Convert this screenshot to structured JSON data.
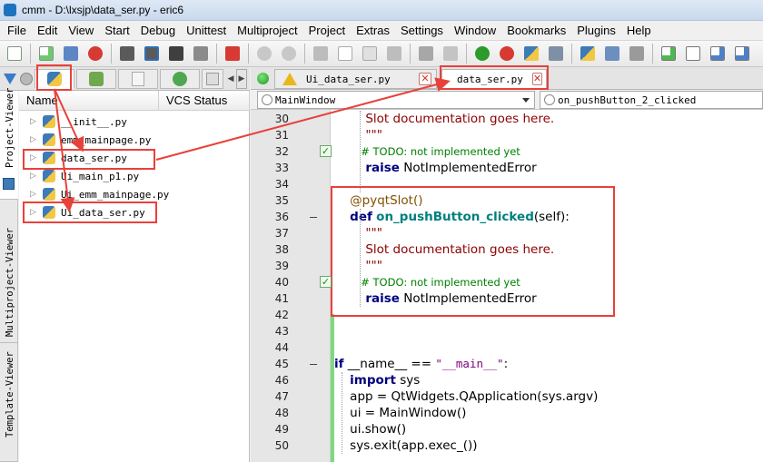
{
  "window": {
    "title": "cmm - D:\\lxsjp\\data_ser.py - eric6"
  },
  "menu": [
    "File",
    "Edit",
    "View",
    "Start",
    "Debug",
    "Unittest",
    "Multiproject",
    "Project",
    "Extras",
    "Settings",
    "Window",
    "Bookmarks",
    "Plugins",
    "Help"
  ],
  "toolbar": {
    "icons": [
      "new-file-icon",
      "new-project-icon",
      "print-icon",
      "close-red-icon",
      "save-icon",
      "save-as-icon",
      "save-all-icon",
      "save-copy-icon",
      "close-all-icon",
      "undo-icon",
      "redo-icon",
      "cut-icon",
      "copy-icon",
      "paste-icon",
      "delete-icon",
      "comment-icon",
      "next-icon",
      "reload-icon",
      "stop-icon",
      "python-run-icon",
      "settings-icon",
      "find-project-icon",
      "find-file-icon",
      "new-window-icon",
      "add-icon",
      "search-file-icon",
      "import-icon",
      "export-icon"
    ]
  },
  "sidebar": {
    "vertical_tabs": [
      "Project-Viewer",
      "Multiproject-Viewer",
      "Template-Viewer"
    ]
  },
  "filelist": {
    "columns": [
      "Name",
      "VCS Status"
    ],
    "files": [
      "__init__.py",
      "emm_mainpage.py",
      "data_ser.py",
      "Ui_main_p1.py",
      "Ui_emm_mainpage.py",
      "Ui_data_ser.py"
    ]
  },
  "editor_tabs": [
    {
      "label": "Ui_data_ser.py",
      "active": false
    },
    {
      "label": "data_ser.py",
      "active": true
    }
  ],
  "combos": {
    "class": "MainWindow",
    "method": "on_pushButton_2_clicked"
  },
  "code": {
    "lines": [
      {
        "n": "30",
        "text": "        Slot documentation goes here.",
        "cls": "s-doc"
      },
      {
        "n": "31",
        "text": "        \"\"\"",
        "cls": "s-doc"
      },
      {
        "n": "32",
        "text": "        # TODO: not implemented yet",
        "cls": "s-com"
      },
      {
        "n": "33",
        "text": "        raise NotImplementedError",
        "cls": "mixed-raise"
      },
      {
        "n": "34",
        "text": "",
        "cls": "s-pl"
      },
      {
        "n": "35",
        "text": "    @pyqtSlot()",
        "cls": "s-dec"
      },
      {
        "n": "36",
        "text": "    def on_pushButton_clicked(self):",
        "cls": "mixed-def"
      },
      {
        "n": "37",
        "text": "        \"\"\"",
        "cls": "s-doc"
      },
      {
        "n": "38",
        "text": "        Slot documentation goes here.",
        "cls": "s-doc"
      },
      {
        "n": "39",
        "text": "        \"\"\"",
        "cls": "s-doc"
      },
      {
        "n": "40",
        "text": "        # TODO: not implemented yet",
        "cls": "s-com"
      },
      {
        "n": "41",
        "text": "        raise NotImplementedError",
        "cls": "mixed-raise"
      },
      {
        "n": "42",
        "text": "",
        "cls": "s-pl"
      },
      {
        "n": "43",
        "text": "",
        "cls": "s-pl"
      },
      {
        "n": "44",
        "text": "",
        "cls": "s-pl"
      },
      {
        "n": "45",
        "text": "if __name__ == \"__main__\":",
        "cls": "mixed-if"
      },
      {
        "n": "46",
        "text": "    import sys",
        "cls": "mixed-import"
      },
      {
        "n": "47",
        "text": "    app = QtWidgets.QApplication(sys.argv)",
        "cls": "s-pl"
      },
      {
        "n": "48",
        "text": "    ui = MainWindow()",
        "cls": "s-pl"
      },
      {
        "n": "49",
        "text": "    ui.show()",
        "cls": "s-pl"
      },
      {
        "n": "50",
        "text": "    sys.exit(app.exec_())",
        "cls": "s-pl"
      }
    ]
  },
  "colors": {
    "annotation": "#e8413a",
    "change_bar": "#7fd87f"
  }
}
